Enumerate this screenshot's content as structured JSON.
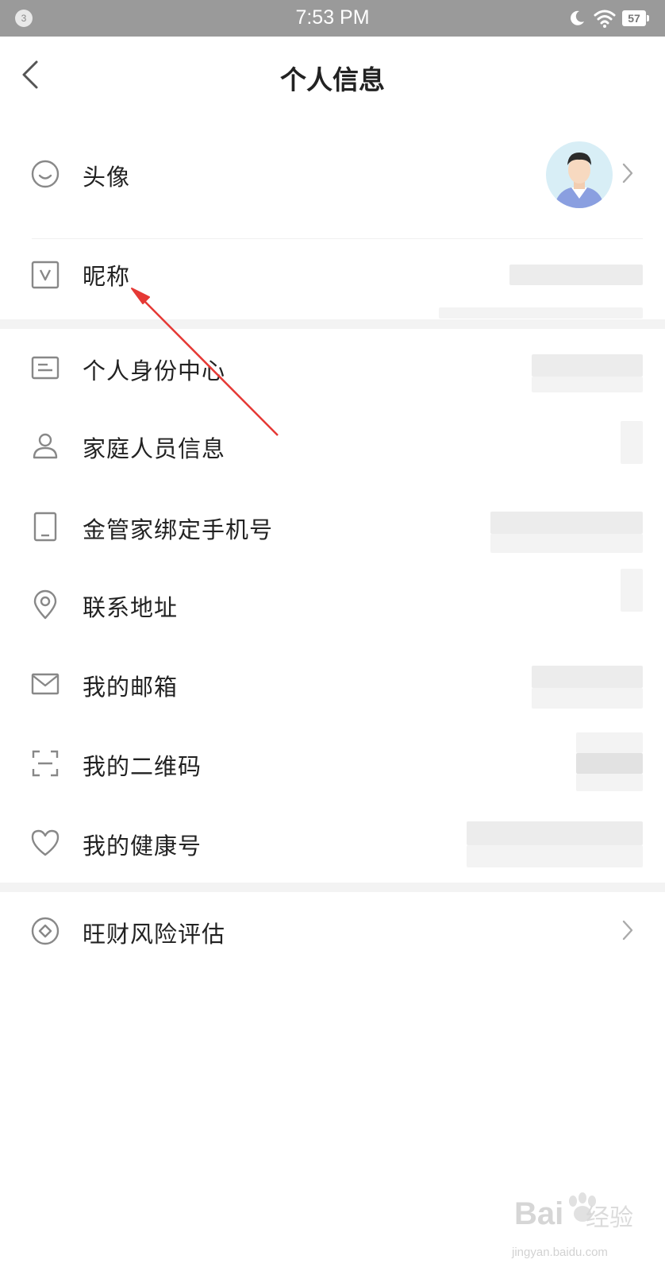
{
  "status_bar": {
    "notification_count": "3",
    "time": "7:53 PM",
    "battery": "57"
  },
  "header": {
    "title": "个人信息",
    "back_icon": "chevron-left-icon"
  },
  "rows": [
    {
      "id": "avatar",
      "label": "头像",
      "icon": "smiley-icon",
      "has_chevron": true
    },
    {
      "id": "nickname",
      "label": "昵称",
      "icon": "v-badge-icon"
    },
    {
      "id": "identity",
      "label": "个人身份中心",
      "icon": "id-card-icon"
    },
    {
      "id": "family",
      "label": "家庭人员信息",
      "icon": "person-icon"
    },
    {
      "id": "phone",
      "label": "金管家绑定手机号",
      "icon": "phone-icon"
    },
    {
      "id": "address",
      "label": "联系地址",
      "icon": "location-pin-icon"
    },
    {
      "id": "email",
      "label": "我的邮箱",
      "icon": "mail-icon"
    },
    {
      "id": "qrcode",
      "label": "我的二维码",
      "icon": "scan-frame-icon"
    },
    {
      "id": "health",
      "label": "我的健康号",
      "icon": "heart-icon"
    },
    {
      "id": "risk",
      "label": "旺财风险评估",
      "icon": "diamond-circle-icon",
      "has_chevron": true
    }
  ],
  "watermark": {
    "brand": "Bai",
    "brand_suffix": "经验",
    "url": "jingyan.baidu.com"
  },
  "colors": {
    "status_bar": "#9a9a9a",
    "annotation_arrow": "#e53935",
    "icon_gray": "#888888",
    "divider": "#f3f3f3"
  }
}
